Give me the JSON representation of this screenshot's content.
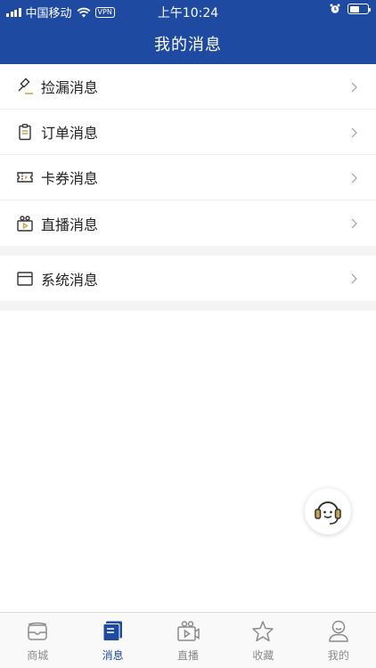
{
  "status_bar": {
    "carrier": "中国移动",
    "vpn": "VPN",
    "time": "上午10:24"
  },
  "header": {
    "title": "我的消息"
  },
  "colors": {
    "brand": "#1f4aa2",
    "icon_accent": "#c9a44a",
    "divider": "#ececec"
  },
  "messages": {
    "groups": [
      [
        {
          "label": "捡漏消息",
          "icon": "gavel-icon"
        },
        {
          "label": "订单消息",
          "icon": "clipboard-icon"
        },
        {
          "label": "卡券消息",
          "icon": "ticket-icon"
        },
        {
          "label": "直播消息",
          "icon": "live-camera-icon"
        }
      ],
      [
        {
          "label": "系统消息",
          "icon": "window-icon"
        }
      ]
    ]
  },
  "customer_service": {
    "icon": "headset-smile-icon"
  },
  "tabbar": {
    "tabs": [
      {
        "label": "商城",
        "icon": "shop-icon",
        "active": false
      },
      {
        "label": "消息",
        "icon": "message-icon",
        "active": true
      },
      {
        "label": "直播",
        "icon": "live-icon",
        "active": false
      },
      {
        "label": "收藏",
        "icon": "star-icon",
        "active": false
      },
      {
        "label": "我的",
        "icon": "user-icon",
        "active": false
      }
    ]
  }
}
